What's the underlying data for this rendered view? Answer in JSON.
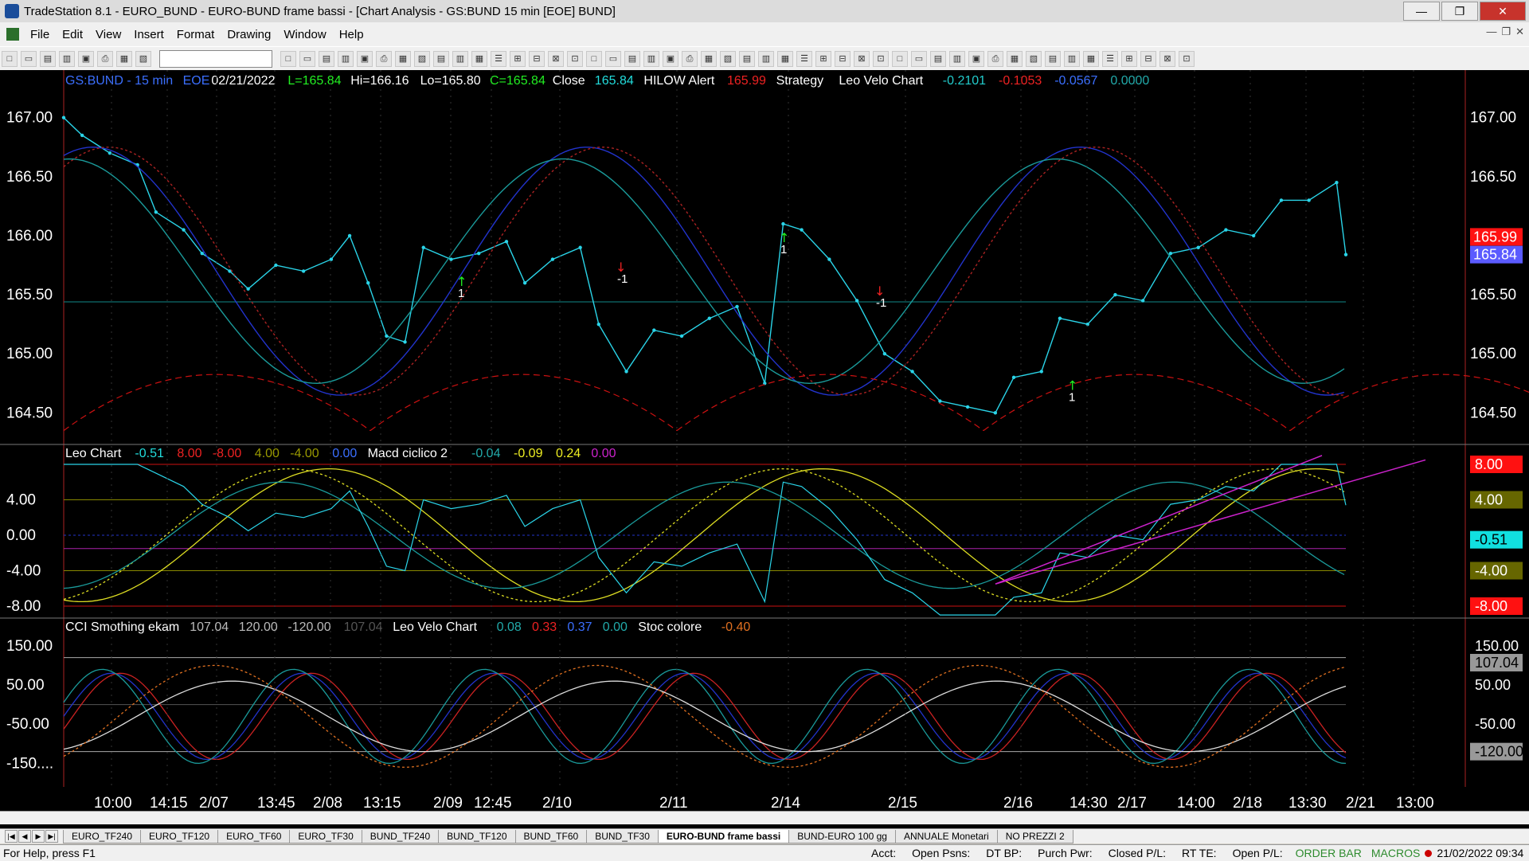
{
  "window": {
    "title": "TradeStation 8.1 - EURO_BUND - EURO-BUND frame bassi - [Chart Analysis - GS:BUND  15 min  [EOE] BUND]",
    "buttons": {
      "minimize": "—",
      "restore": "❐",
      "close": "✕"
    }
  },
  "menu": {
    "items": [
      "File",
      "Edit",
      "View",
      "Insert",
      "Format",
      "Drawing",
      "Window",
      "Help"
    ]
  },
  "panel1": {
    "header": [
      {
        "t": "GS:BUND - 15 min",
        "c": "#3b6fff"
      },
      {
        "t": "EOE",
        "c": "#3b6fff"
      },
      {
        "t": "02/21/2022",
        "c": "#ffffff"
      },
      {
        "t": "L=165.84",
        "c": "#22ee22"
      },
      {
        "t": "Hi=166.16",
        "c": "#ffffff"
      },
      {
        "t": "Lo=165.80",
        "c": "#ffffff"
      },
      {
        "t": "C=165.84",
        "c": "#22ee22"
      },
      {
        "t": "Close",
        "c": "#ffffff"
      },
      {
        "t": "165.84",
        "c": "#22dddd"
      },
      {
        "t": "HILOW Alert",
        "c": "#ffffff"
      },
      {
        "t": "165.99",
        "c": "#ee2222"
      },
      {
        "t": "Strategy",
        "c": "#ffffff"
      },
      {
        "t": "Leo Velo Chart",
        "c": "#ffffff"
      },
      {
        "t": "-0.2101",
        "c": "#22cccc"
      },
      {
        "t": "-0.1053",
        "c": "#ee2222"
      },
      {
        "t": "-0.0567",
        "c": "#3b6fff"
      },
      {
        "t": "0.0000",
        "c": "#22aaaa"
      }
    ],
    "yticks": [
      "167.00",
      "166.50",
      "166.00",
      "165.50",
      "165.00",
      "164.50"
    ],
    "price_tags": [
      {
        "t": "165.99",
        "bg": "#ff1111"
      },
      {
        "t": "165.84",
        "bg": "#5b5bff"
      }
    ],
    "markers": [
      "1",
      "-1",
      "1",
      "-1",
      "1"
    ]
  },
  "panel2": {
    "header": [
      {
        "t": "Leo Chart",
        "c": "#ffffff"
      },
      {
        "t": "-0.51",
        "c": "#22dddd"
      },
      {
        "t": "8.00",
        "c": "#ee2222"
      },
      {
        "t": "-8.00",
        "c": "#ee2222"
      },
      {
        "t": "4.00",
        "c": "#999900"
      },
      {
        "t": "-4.00",
        "c": "#999900"
      },
      {
        "t": "0.00",
        "c": "#3b6fff"
      },
      {
        "t": "Macd ciclico 2",
        "c": "#ffffff"
      },
      {
        "t": "-0.04",
        "c": "#22aaaa"
      },
      {
        "t": "-0.09",
        "c": "#eeee22"
      },
      {
        "t": "0.24",
        "c": "#eeee22"
      },
      {
        "t": "0.00",
        "c": "#cc22cc"
      }
    ],
    "yticks": [
      "4.00",
      "0.00",
      "-4.00",
      "-8.00"
    ],
    "tags": [
      {
        "t": "8.00",
        "bg": "#ff1111",
        "fg": "#ffffff"
      },
      {
        "t": "4.00",
        "bg": "#666600",
        "fg": "#ffffff"
      },
      {
        "t": "-0.51",
        "bg": "#11e0e0",
        "fg": "#000000"
      },
      {
        "t": "-4.00",
        "bg": "#666600",
        "fg": "#ffffff"
      },
      {
        "t": "-8.00",
        "bg": "#ff1111",
        "fg": "#ffffff"
      }
    ]
  },
  "panel3": {
    "header": [
      {
        "t": "CCI Smothing ekam",
        "c": "#ffffff"
      },
      {
        "t": "107.04",
        "c": "#bbbbbb"
      },
      {
        "t": "120.00",
        "c": "#bbbbbb"
      },
      {
        "t": "-120.00",
        "c": "#bbbbbb"
      },
      {
        "t": "107.04",
        "c": "#555555"
      },
      {
        "t": "Leo Velo Chart",
        "c": "#ffffff"
      },
      {
        "t": "0.08",
        "c": "#22aaaa"
      },
      {
        "t": "0.33",
        "c": "#ee2222"
      },
      {
        "t": "0.37",
        "c": "#3b6fff"
      },
      {
        "t": "0.00",
        "c": "#22aaaa"
      },
      {
        "t": "Stoc colore",
        "c": "#ffffff"
      },
      {
        "t": "-0.40",
        "c": "#e07020"
      }
    ],
    "yticks": [
      "150.00",
      "50.00",
      "-50.00",
      "-150...."
    ],
    "tags": [
      {
        "t": "150.00",
        "bg": "#000000",
        "fg": "#ffffff"
      },
      {
        "t": "107.04",
        "bg": "#999999",
        "fg": "#000000"
      },
      {
        "t": "50.00",
        "bg": "#000000",
        "fg": "#ffffff"
      },
      {
        "t": "-50.00",
        "bg": "#000000",
        "fg": "#ffffff"
      },
      {
        "t": "-120.00",
        "bg": "#999999",
        "fg": "#000000"
      }
    ]
  },
  "xaxis": [
    "10:00",
    "14:15",
    "2/07",
    "13:45",
    "2/08",
    "13:15",
    "2/09",
    "12:45",
    "2/10",
    "2/11",
    "2/14",
    "2/15",
    "2/16",
    "14:30",
    "2/17",
    "14:00",
    "2/18",
    "13:30",
    "2/21",
    "13:00"
  ],
  "tabs": [
    "EURO_TF240",
    "EURO_TF120",
    "EURO_TF60",
    "EURO_TF30",
    "BUND_TF240",
    "BUND_TF120",
    "BUND_TF60",
    "BUND_TF30",
    "EURO-BUND frame bassi",
    "BUND-EURO 100 gg",
    "ANNUALE Monetari",
    "NO PREZZI 2"
  ],
  "active_tab": "EURO-BUND frame bassi",
  "status": {
    "help": "For Help, press F1",
    "fields": [
      "Acct:",
      "Open Psns:",
      "DT BP:",
      "Purch Pwr:",
      "Closed P/L:",
      "RT TE:",
      "Open P/L:"
    ],
    "order_bar": "ORDER BAR",
    "macros": "MACROS",
    "datetime": "21/02/2022 09:34"
  },
  "chart_data": {
    "type": "line",
    "title": "",
    "series_price": [
      {
        "t": 0,
        "v": 167.0
      },
      {
        "t": 2,
        "v": 166.85
      },
      {
        "t": 5,
        "v": 166.7
      },
      {
        "t": 8,
        "v": 166.6
      },
      {
        "t": 10,
        "v": 166.2
      },
      {
        "t": 13,
        "v": 166.05
      },
      {
        "t": 15,
        "v": 165.85
      },
      {
        "t": 18,
        "v": 165.7
      },
      {
        "t": 20,
        "v": 165.55
      },
      {
        "t": 23,
        "v": 165.75
      },
      {
        "t": 26,
        "v": 165.7
      },
      {
        "t": 29,
        "v": 165.8
      },
      {
        "t": 31,
        "v": 166.0
      },
      {
        "t": 33,
        "v": 165.6
      },
      {
        "t": 35,
        "v": 165.15
      },
      {
        "t": 37,
        "v": 165.1
      },
      {
        "t": 39,
        "v": 165.9
      },
      {
        "t": 42,
        "v": 165.8
      },
      {
        "t": 45,
        "v": 165.85
      },
      {
        "t": 48,
        "v": 165.95
      },
      {
        "t": 50,
        "v": 165.6
      },
      {
        "t": 53,
        "v": 165.8
      },
      {
        "t": 56,
        "v": 165.9
      },
      {
        "t": 58,
        "v": 165.25
      },
      {
        "t": 61,
        "v": 164.85
      },
      {
        "t": 64,
        "v": 165.2
      },
      {
        "t": 67,
        "v": 165.15
      },
      {
        "t": 70,
        "v": 165.3
      },
      {
        "t": 73,
        "v": 165.4
      },
      {
        "t": 76,
        "v": 164.75
      },
      {
        "t": 78,
        "v": 166.1
      },
      {
        "t": 80,
        "v": 166.05
      },
      {
        "t": 83,
        "v": 165.8
      },
      {
        "t": 86,
        "v": 165.45
      },
      {
        "t": 89,
        "v": 165.0
      },
      {
        "t": 92,
        "v": 164.85
      },
      {
        "t": 95,
        "v": 164.6
      },
      {
        "t": 98,
        "v": 164.55
      },
      {
        "t": 101,
        "v": 164.5
      },
      {
        "t": 103,
        "v": 164.8
      },
      {
        "t": 106,
        "v": 164.85
      },
      {
        "t": 108,
        "v": 165.3
      },
      {
        "t": 111,
        "v": 165.25
      },
      {
        "t": 114,
        "v": 165.5
      },
      {
        "t": 117,
        "v": 165.45
      },
      {
        "t": 120,
        "v": 165.85
      },
      {
        "t": 123,
        "v": 165.9
      },
      {
        "t": 126,
        "v": 166.05
      },
      {
        "t": 129,
        "v": 166.0
      },
      {
        "t": 132,
        "v": 166.3
      },
      {
        "t": 135,
        "v": 166.3
      },
      {
        "t": 138,
        "v": 166.45
      },
      {
        "t": 139,
        "v": 165.84
      }
    ],
    "yrange": [
      164.3,
      167.2
    ]
  }
}
